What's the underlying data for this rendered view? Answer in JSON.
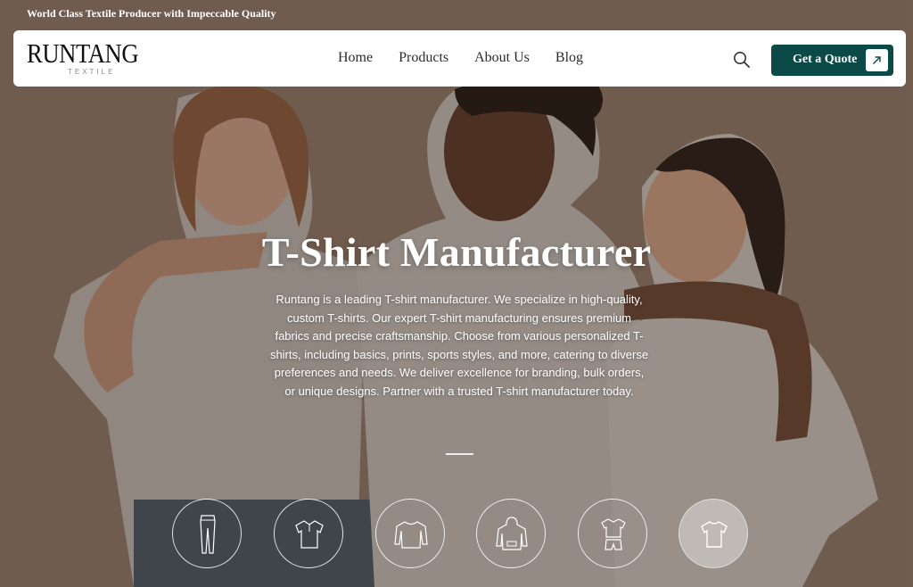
{
  "topbar": {
    "tagline": "World Class Textile Producer with Impeccable Quality"
  },
  "header": {
    "logo": {
      "word": "RUNTANG",
      "sub": "TEXTILE"
    },
    "nav": [
      "Home",
      "Products",
      "About Us",
      "Blog"
    ],
    "search_icon": "search-icon",
    "cta": {
      "label": "Get a Quote",
      "icon": "arrow-up-right-icon"
    }
  },
  "hero": {
    "title": "T-Shirt Manufacturer",
    "description": "Runtang is a leading T-shirt manufacturer. We specialize in high-quality, custom T-shirts. Our expert T-shirt manufacturing ensures premium fabrics and precise craftsmanship. Choose from various personalized T-shirts, including basics, prints, sports styles, and more, catering to diverse preferences and needs. We deliver excellence for branding, bulk orders, or unique designs. Partner with a trusted T-shirt manufacturer today."
  },
  "categories": [
    {
      "icon": "leggings-icon",
      "active": false
    },
    {
      "icon": "polo-shirt-icon",
      "active": false
    },
    {
      "icon": "sweatshirt-icon",
      "active": false
    },
    {
      "icon": "hoodie-icon",
      "active": false
    },
    {
      "icon": "sportswear-set-icon",
      "active": false
    },
    {
      "icon": "t-shirt-icon",
      "active": true
    }
  ],
  "colors": {
    "accent": "#0c4a47",
    "header_bg": "#ffffff",
    "text_light": "#ffffff"
  }
}
